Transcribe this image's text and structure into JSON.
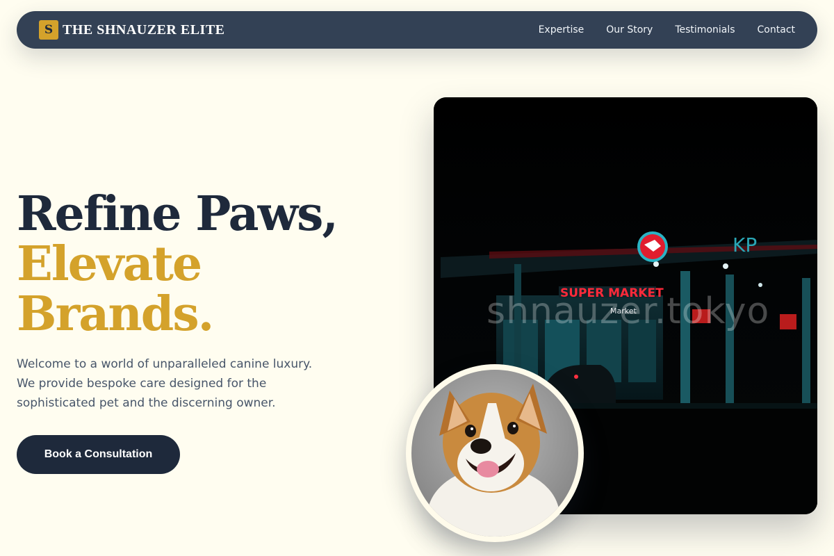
{
  "nav": {
    "brand_mark": "S",
    "brand_name": "THE SHNAUZER ELITE",
    "links": [
      "Expertise",
      "Our Story",
      "Testimonials",
      "Contact"
    ]
  },
  "hero": {
    "headline_line1": "Refine Paws,",
    "headline_line2": "Elevate Brands.",
    "intro": "Welcome to a world of unparalleled canine luxury. We provide bespoke care designed for the sophisticated pet and the discerning owner.",
    "cta_label": "Book a Consultation"
  },
  "scene": {
    "sign_text": "SUPER MARKET",
    "sub_sign_text": "Market",
    "letters": "KP",
    "watermark": "shnauzer.tokyo"
  },
  "colors": {
    "background": "#fffdf0",
    "navy": "#1e293b",
    "nav_bg": "#334155",
    "gold": "#d4a22b",
    "body_text": "#475569"
  }
}
